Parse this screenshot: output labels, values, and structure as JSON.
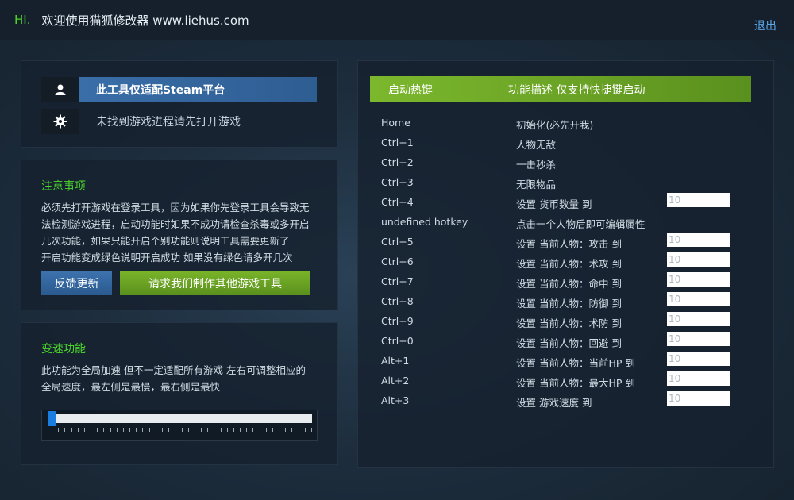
{
  "header": {
    "hi": "HI.",
    "title": "欢迎使用猫狐修改器 www.liehus.com",
    "logout": "退出"
  },
  "platform": {
    "steam_label": "此工具仅适配Steam平台",
    "status": "未找到游戏进程请先打开游戏",
    "icons": [
      "user-icon",
      "gear-icon"
    ]
  },
  "notice": {
    "title": "注意事项",
    "lines": [
      "必须先打开游戏在登录工具，因为如果你先登录工具会导致无",
      "法检测游戏进程，启动功能时如果不成功请检查杀毒或多开启",
      "几次功能，如果只能开启个别功能则说明工具需要更新了",
      "开启功能变成绿色说明开启成功 如果没有绿色请多开几次"
    ],
    "feedback_button": "反馈更新",
    "request_button": "请求我们制作其他游戏工具"
  },
  "speed": {
    "title": "变速功能",
    "lines": [
      "此功能为全局加速 但不一定适配所有游戏 左右可调整相应的",
      "全局速度，最左侧是最慢，最右侧是最快"
    ],
    "slider_value": 0.0
  },
  "hotkeys": {
    "header_key": "启动热键",
    "header_desc": "功能描述 仅支持快捷键启动",
    "rows": [
      {
        "key": "Home",
        "desc": "初始化(必先开我)"
      },
      {
        "key": "Ctrl+1",
        "desc": "人物无敌"
      },
      {
        "key": "Ctrl+2",
        "desc": "一击秒杀"
      },
      {
        "key": "Ctrl+3",
        "desc": "无限物品"
      },
      {
        "key": "Ctrl+4",
        "desc": "设置 货币数量 到",
        "input": "10"
      },
      {
        "key": "undefined hotkey",
        "desc": "点击一个人物后即可编辑属性"
      },
      {
        "key": "Ctrl+5",
        "desc": "设置 当前人物：攻击 到",
        "input": "10"
      },
      {
        "key": "Ctrl+6",
        "desc": "设置 当前人物：术攻 到",
        "input": "10"
      },
      {
        "key": "Ctrl+7",
        "desc": "设置 当前人物：命中 到",
        "input": "10"
      },
      {
        "key": "Ctrl+8",
        "desc": "设置 当前人物：防御 到",
        "input": "10"
      },
      {
        "key": "Ctrl+9",
        "desc": "设置 当前人物：术防 到",
        "input": "10"
      },
      {
        "key": "Ctrl+0",
        "desc": "设置 当前人物：回避 到",
        "input": "10"
      },
      {
        "key": "Alt+1",
        "desc": "设置 当前人物：当前HP 到",
        "input": "10"
      },
      {
        "key": "Alt+2",
        "desc": "设置 当前人物：最大HP 到",
        "input": "10"
      },
      {
        "key": "Alt+3",
        "desc": "设置 游戏速度 到",
        "input": "10"
      }
    ]
  },
  "colors": {
    "accent_green": "#4bd82b",
    "steam_blue": "#3a6ea8",
    "button_green": "#6aa224",
    "link_blue": "#5aa5e6"
  }
}
